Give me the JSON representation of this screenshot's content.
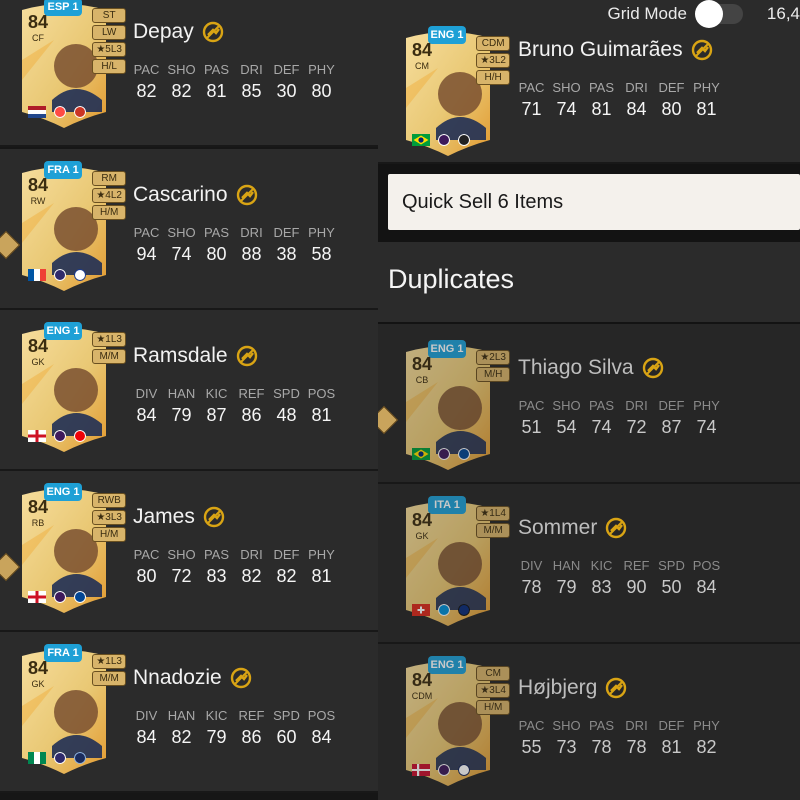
{
  "header": {
    "grid_mode_label": "Grid Mode",
    "grid_mode_on": false,
    "count": "16,4"
  },
  "quick_sell": {
    "label": "Quick Sell 6 Items"
  },
  "duplicates": {
    "title": "Duplicates"
  },
  "colors": {
    "card_gold": "#e9c874",
    "league_badge": "#1ea0d6",
    "evo_icon": "#d9a414",
    "row_bg": "#2b2b2b"
  },
  "left_players": [
    {
      "name": "Depay",
      "rating": "84",
      "position": "CF",
      "league": "ESP 1",
      "tags": [
        "ST",
        "LW",
        "★5L3",
        "H/L"
      ],
      "stat_labels": [
        "PAC",
        "SHO",
        "PAS",
        "DRI",
        "DEF",
        "PHY"
      ],
      "stats": [
        "82",
        "82",
        "81",
        "85",
        "30",
        "80"
      ],
      "flag": "netherlands",
      "club": "atletico-madrid",
      "league_logo": "laliga"
    },
    {
      "name": "Cascarino",
      "rating": "84",
      "position": "RW",
      "league": "FRA 1",
      "tags": [
        "RM",
        "★4L2",
        "H/M"
      ],
      "stat_labels": [
        "PAC",
        "SHO",
        "PAS",
        "DRI",
        "DEF",
        "PHY"
      ],
      "stats": [
        "94",
        "74",
        "80",
        "88",
        "38",
        "58"
      ],
      "flag": "france",
      "club": "lyon",
      "league_logo": "d1-arkema"
    },
    {
      "name": "Ramsdale",
      "rating": "84",
      "position": "GK",
      "league": "ENG 1",
      "tags": [
        "★1L3",
        "M/M"
      ],
      "stat_labels": [
        "DIV",
        "HAN",
        "KIC",
        "REF",
        "SPD",
        "POS"
      ],
      "stats": [
        "84",
        "79",
        "87",
        "86",
        "48",
        "81"
      ],
      "flag": "england",
      "club": "arsenal",
      "league_logo": "premier-league"
    },
    {
      "name": "James",
      "rating": "84",
      "position": "RB",
      "league": "ENG 1",
      "tags": [
        "RWB",
        "★3L3",
        "H/M"
      ],
      "stat_labels": [
        "PAC",
        "SHO",
        "PAS",
        "DRI",
        "DEF",
        "PHY"
      ],
      "stats": [
        "80",
        "72",
        "83",
        "82",
        "82",
        "81"
      ],
      "flag": "england",
      "club": "chelsea",
      "league_logo": "premier-league"
    },
    {
      "name": "Nnadozie",
      "rating": "84",
      "position": "GK",
      "league": "FRA 1",
      "tags": [
        "★1L3",
        "M/M"
      ],
      "stat_labels": [
        "DIV",
        "HAN",
        "KIC",
        "REF",
        "SPD",
        "POS"
      ],
      "stats": [
        "84",
        "82",
        "79",
        "86",
        "60",
        "84"
      ],
      "flag": "nigeria",
      "club": "paris-fc",
      "league_logo": "d1-arkema"
    }
  ],
  "right_players": [
    {
      "name": "Bruno Guimarães",
      "rating": "84",
      "position": "CM",
      "league": "ENG 1",
      "tags": [
        "CDM",
        "★3L2",
        "H/H"
      ],
      "stat_labels": [
        "PAC",
        "SHO",
        "PAS",
        "DRI",
        "DEF",
        "PHY"
      ],
      "stats": [
        "71",
        "74",
        "81",
        "84",
        "80",
        "81"
      ],
      "flag": "brazil",
      "club": "newcastle",
      "league_logo": "premier-league"
    },
    {
      "name": "Thiago Silva",
      "rating": "84",
      "position": "CB",
      "league": "ENG 1",
      "tags": [
        "★2L3",
        "M/H"
      ],
      "stat_labels": [
        "PAC",
        "SHO",
        "PAS",
        "DRI",
        "DEF",
        "PHY"
      ],
      "stats": [
        "51",
        "54",
        "74",
        "72",
        "87",
        "74"
      ],
      "flag": "brazil",
      "club": "chelsea",
      "league_logo": "premier-league"
    },
    {
      "name": "Sommer",
      "rating": "84",
      "position": "GK",
      "league": "ITA 1",
      "tags": [
        "★1L4",
        "M/M"
      ],
      "stat_labels": [
        "DIV",
        "HAN",
        "KIC",
        "REF",
        "SPD",
        "POS"
      ],
      "stats": [
        "78",
        "79",
        "83",
        "90",
        "50",
        "84"
      ],
      "flag": "switzerland",
      "club": "inter",
      "league_logo": "serie-a"
    },
    {
      "name": "Højbjerg",
      "rating": "84",
      "position": "CDM",
      "league": "ENG 1",
      "tags": [
        "CM",
        "★3L4",
        "H/M"
      ],
      "stat_labels": [
        "PAC",
        "SHO",
        "PAS",
        "DRI",
        "DEF",
        "PHY"
      ],
      "stats": [
        "55",
        "73",
        "78",
        "78",
        "81",
        "82"
      ],
      "flag": "denmark",
      "club": "tottenham",
      "league_logo": "premier-league"
    }
  ]
}
